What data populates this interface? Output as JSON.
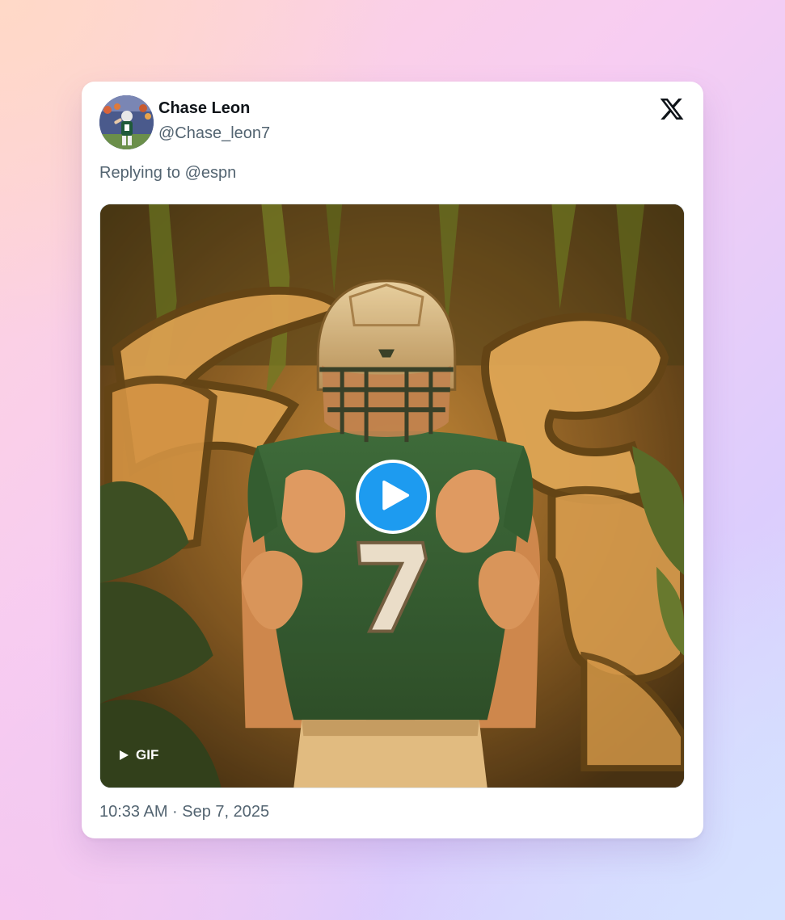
{
  "tweet": {
    "author": {
      "display_name": "Chase Leon",
      "handle": "@Chase_leon7",
      "avatar_icon": "profile-photo"
    },
    "platform_icon": "x-logo-icon",
    "replying_to_prefix": "Replying to",
    "replying_to_handle": "@espn",
    "media": {
      "type": "gif",
      "badge_label": "GIF",
      "play_icon": "play-icon",
      "jersey_number": "7",
      "accent_color": "#1d9bf0"
    },
    "timestamp": "10:33 AM · Sep 7, 2025"
  }
}
